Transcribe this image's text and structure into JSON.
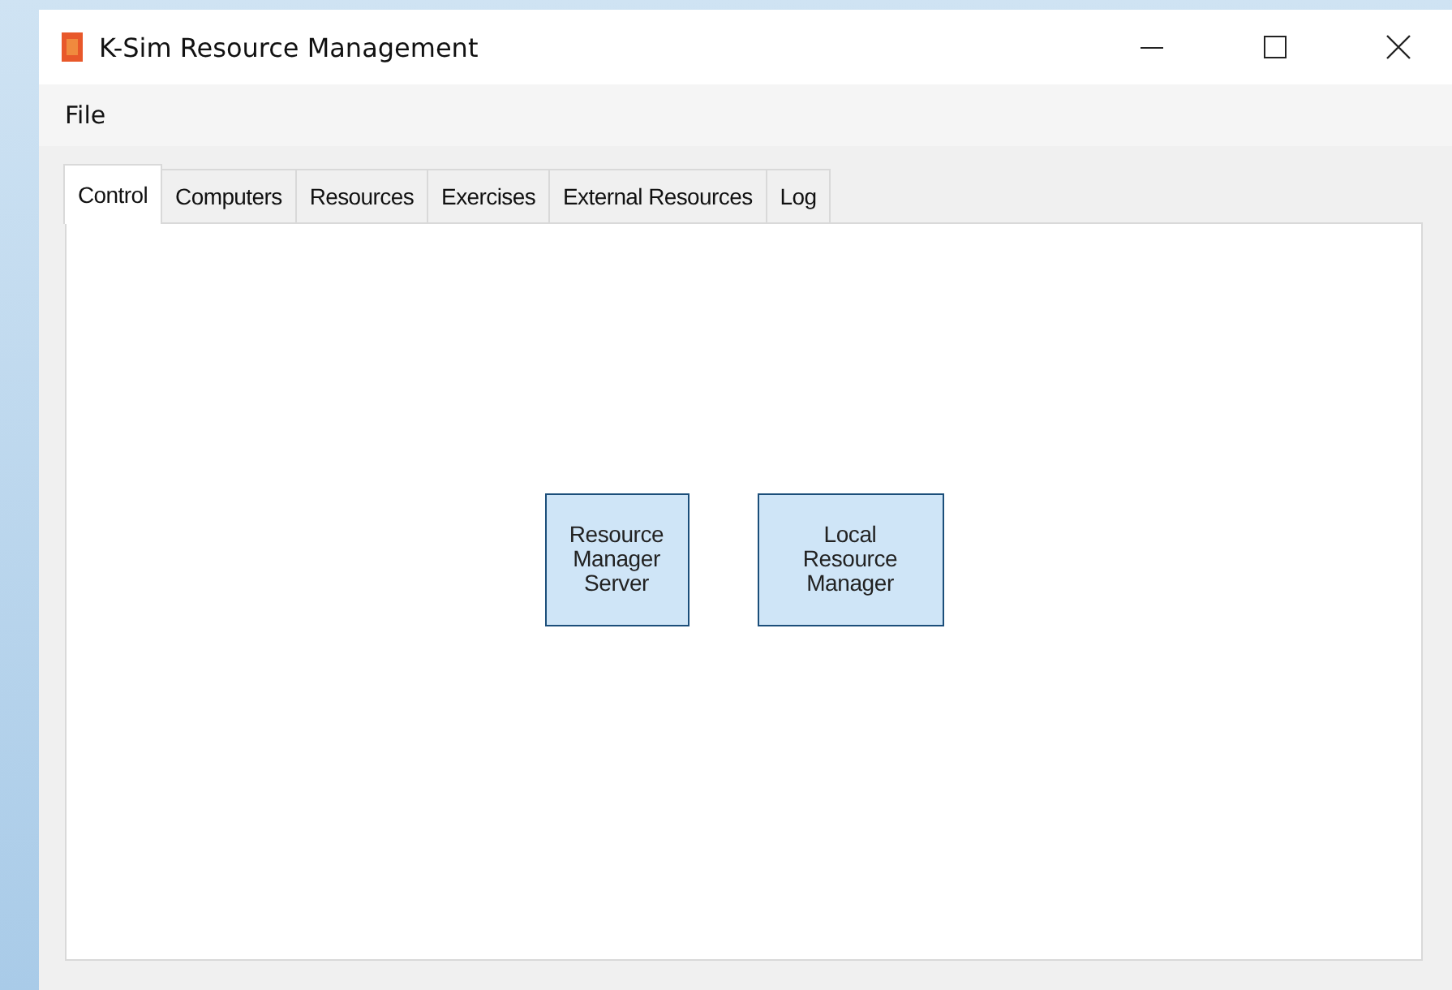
{
  "window": {
    "title": "K-Sim Resource Management"
  },
  "menu": [
    "File"
  ],
  "tabs": [
    {
      "label": "Control",
      "selected": true
    },
    {
      "label": "Computers",
      "selected": false
    },
    {
      "label": "Resources",
      "selected": false
    },
    {
      "label": "Exercises",
      "selected": false
    },
    {
      "label": "External Resources",
      "selected": false
    },
    {
      "label": "Log",
      "selected": false
    }
  ],
  "buttons": [
    "Resource Manager Server",
    "Local Resource Manager"
  ]
}
